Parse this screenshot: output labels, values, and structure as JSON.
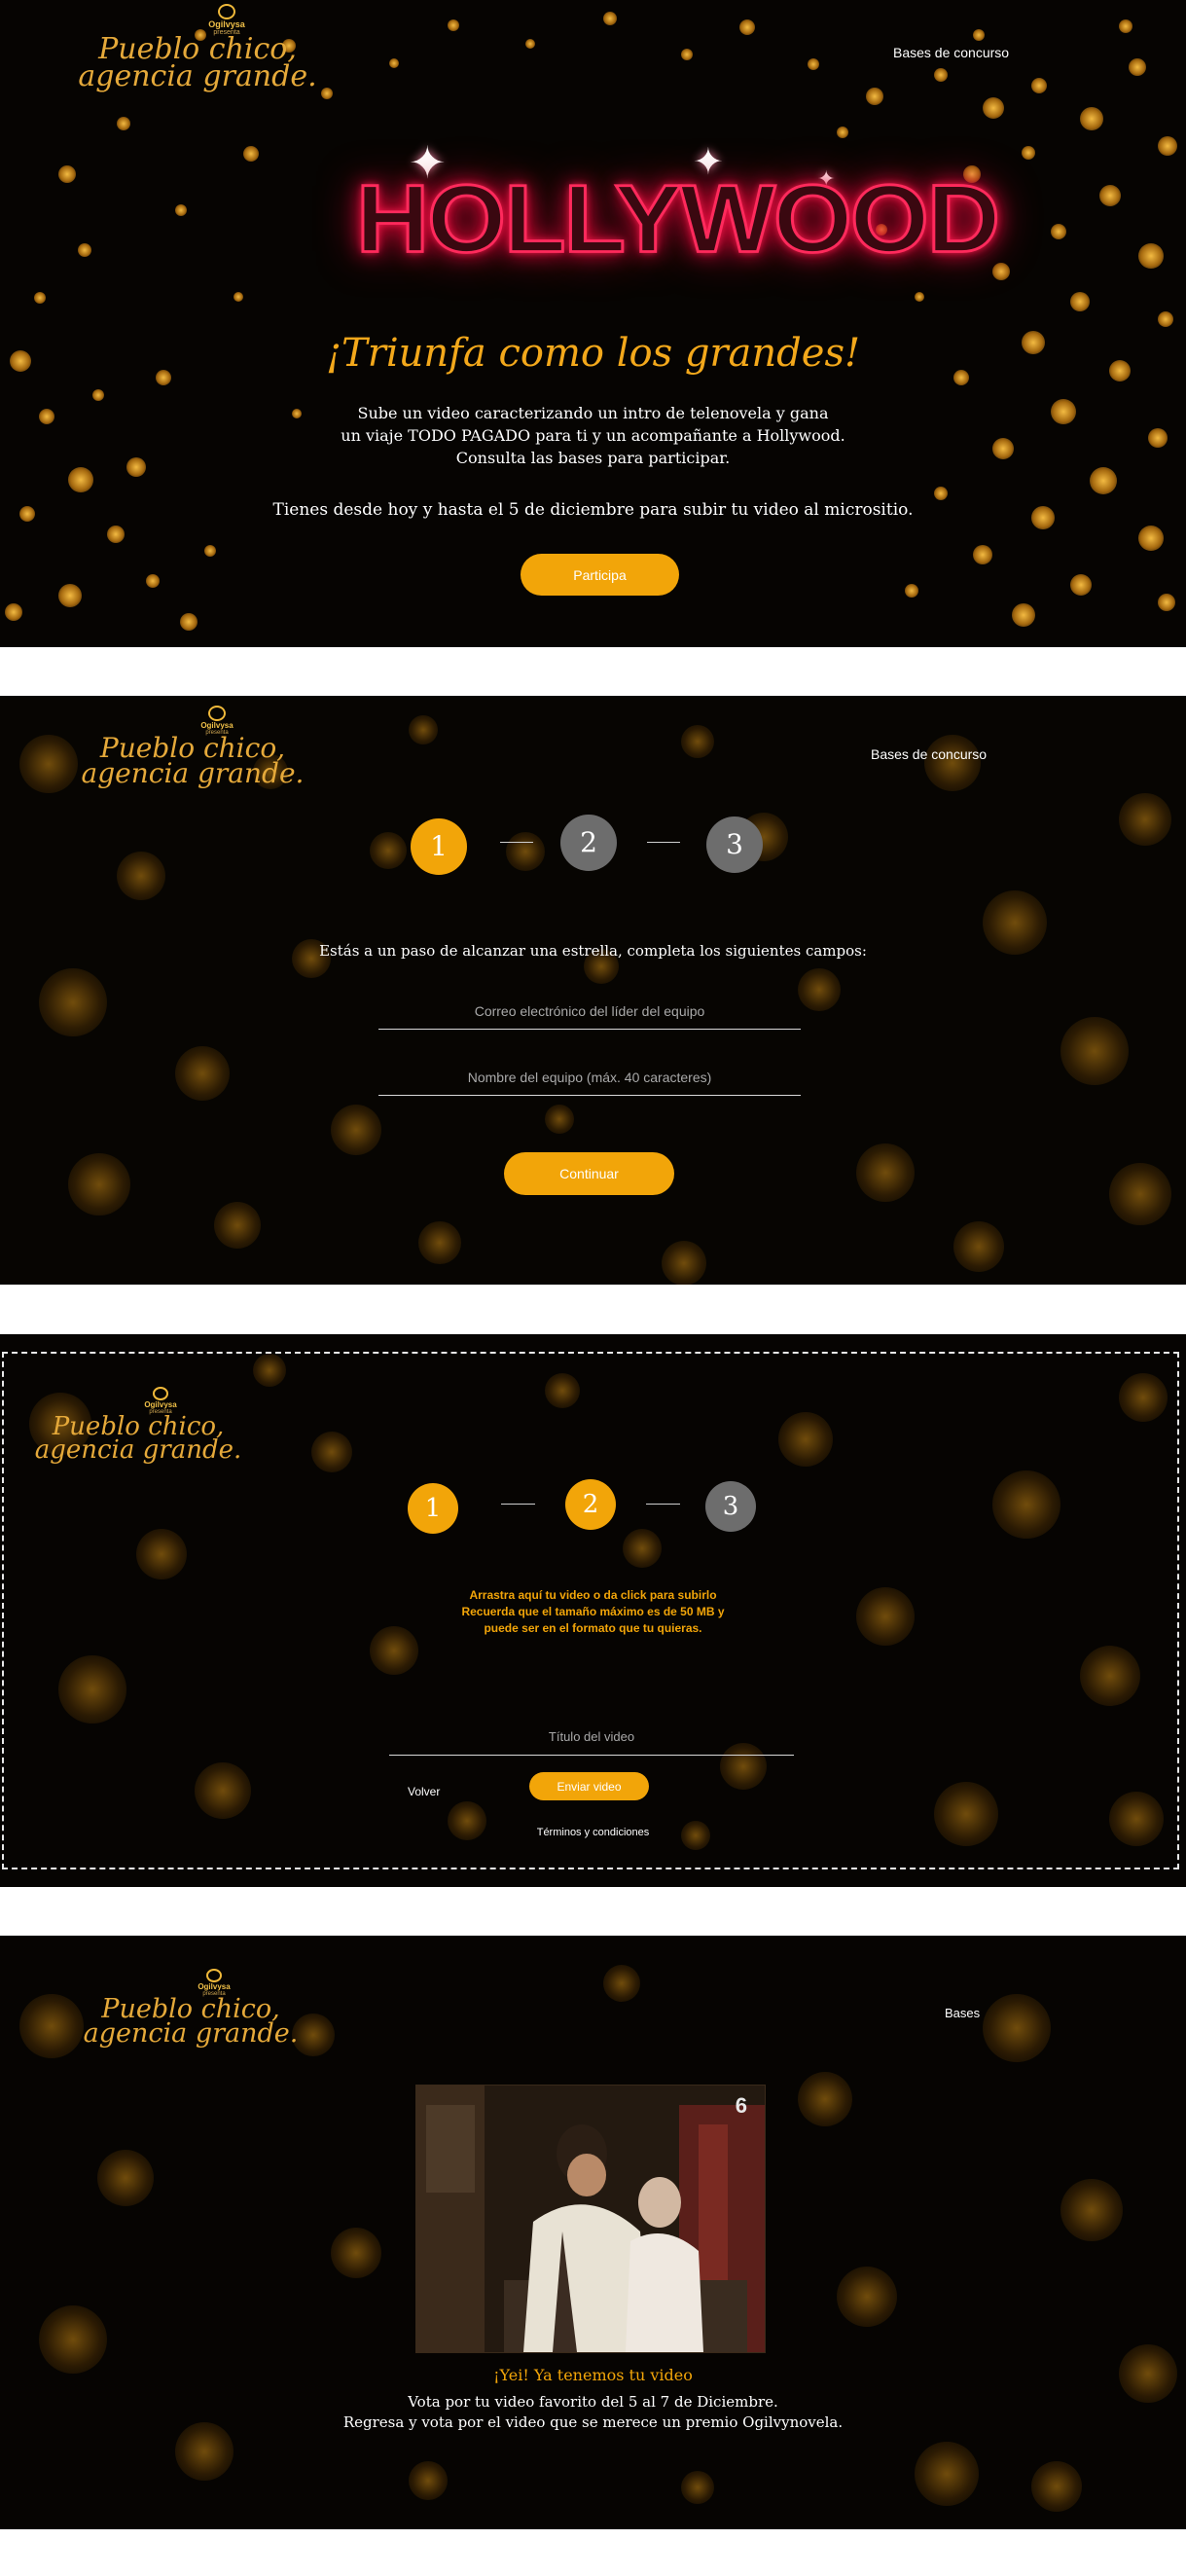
{
  "hero": {
    "logo": {
      "brand": "Ogilvysa",
      "presents": "presenta",
      "line1": "Pueblo chico,",
      "line2": "agencia grande."
    },
    "nav_link": "Bases de concurso",
    "headline": "HOLLYWOOD",
    "tagline": "¡Triunfa como los grandes!",
    "description": [
      "Sube un video caracterizando un intro de telenovela y gana",
      "un viaje TODO PAGADO para ti y un acompañante a Hollywood.",
      "Consulta las bases para participar."
    ],
    "deadline": "Tienes desde hoy y hasta el 5 de diciembre para subir tu video al micrositio.",
    "cta": "Participa"
  },
  "step1": {
    "logo": {
      "brand": "Ogilvysa",
      "presents": "presenta",
      "line1": "Pueblo chico,",
      "line2": "agencia grande."
    },
    "nav_link": "Bases de concurso",
    "steps": [
      "1",
      "2",
      "3"
    ],
    "active_step": 1,
    "prompt": "Estás a un paso de alcanzar una estrella, completa los siguientes campos:",
    "email_placeholder": "Correo electrónico del líder del equipo",
    "team_placeholder": "Nombre del equipo (máx. 40 caracteres)",
    "cta": "Continuar"
  },
  "step2": {
    "logo": {
      "brand": "Ogilvysa",
      "presents": "presenta",
      "line1": "Pueblo chico,",
      "line2": "agencia grande."
    },
    "steps": [
      "1",
      "2",
      "3"
    ],
    "active_steps": [
      1,
      2
    ],
    "upload_lines": [
      "Arrastra aquí tu video o da click para subirlo",
      "Recuerda que el tamaño máximo es de 50 MB y",
      "puede ser en el formato que tu quieras."
    ],
    "title_placeholder": "Título del video",
    "back": "Volver",
    "cta": "Enviar video",
    "terms": "Términos y condiciones"
  },
  "confirm": {
    "logo": {
      "brand": "Ogilvysa",
      "presents": "presenta",
      "line1": "Pueblo chico,",
      "line2": "agencia grande."
    },
    "nav_link": "Bases",
    "video_logo": "6",
    "heading": "¡Yei! Ya tenemos tu video",
    "lines": [
      "Vota por tu video favorito del 5 al 7 de Diciembre.",
      "Regresa y vota por el video que se merece un premio Ogilvynovela."
    ]
  },
  "colors": {
    "accent": "#f2a509",
    "step_idle": "#6d6d6d",
    "neon": "#ff2a5c",
    "script_gold": "#e5a93a"
  }
}
